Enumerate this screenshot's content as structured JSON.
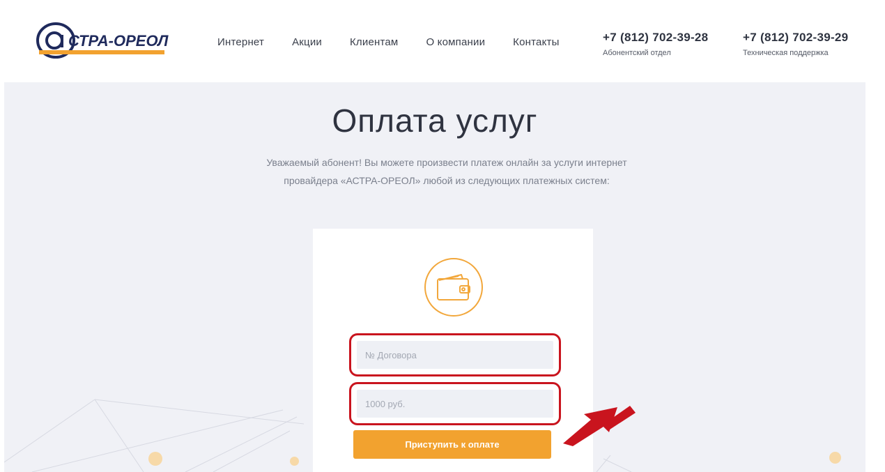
{
  "header": {
    "logo_text": "@СТРА-ОРЕОЛ",
    "nav": [
      "Интернет",
      "Акции",
      "Клиентам",
      "О компании",
      "Контакты"
    ],
    "phones": [
      {
        "number": "+7 (812) 702-39-28",
        "label": "Абонентский отдел"
      },
      {
        "number": "+7 (812) 702-39-29",
        "label": "Техническая поддержка"
      }
    ]
  },
  "main": {
    "title": "Оплата услуг",
    "intro_line1": "Уважаемый абонент! Вы можете произвести платеж онлайн за услуги интернет",
    "intro_line2": "провайдера «АСТРА-ОРЕОЛ» любой из следующих платежных систем:"
  },
  "form": {
    "icon": "wallet-icon",
    "contract_placeholder": "№ Договора",
    "amount_placeholder": "1000 руб.",
    "submit_label": "Приступить к оплате"
  },
  "colors": {
    "accent": "#f2a22f",
    "highlight": "#c9141e",
    "background": "#f0f1f6",
    "logo_blue": "#1f2a5c"
  }
}
